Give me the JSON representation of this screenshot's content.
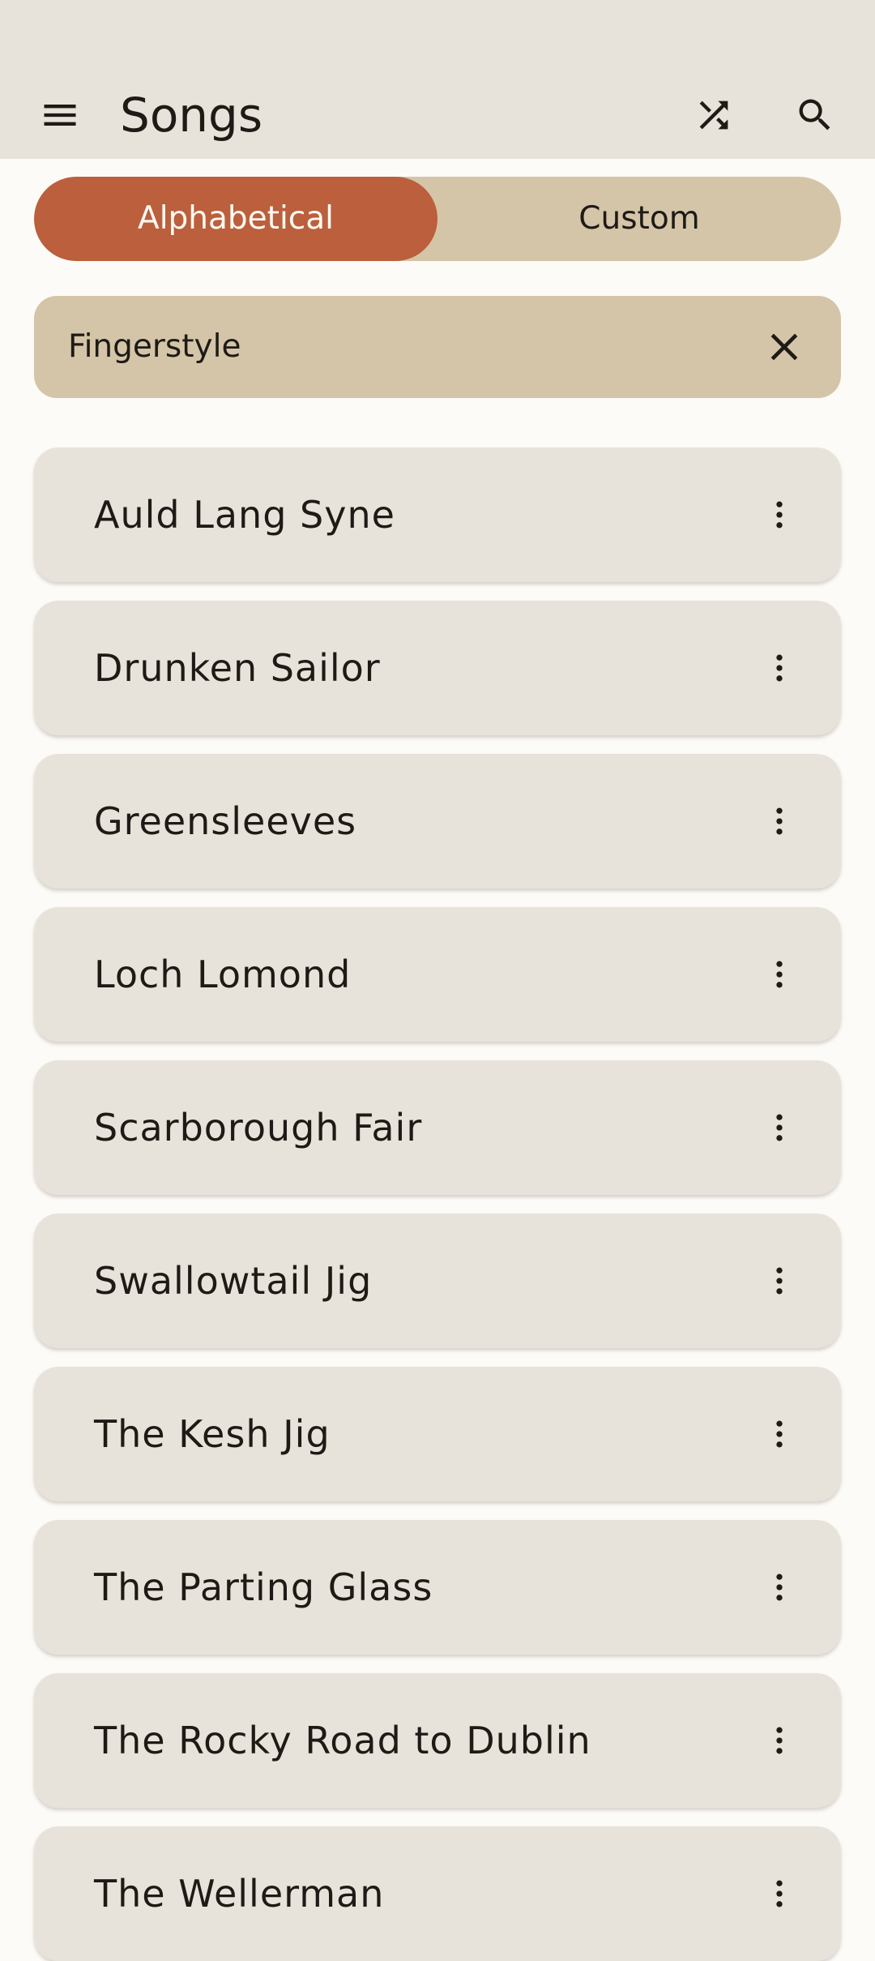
{
  "app_bar": {
    "title": "Songs",
    "menu_icon": "menu-icon",
    "shuffle_icon": "shuffle-icon",
    "search_icon": "search-icon"
  },
  "sort_toggle": {
    "options": [
      {
        "label": "Alphabetical",
        "selected": true
      },
      {
        "label": "Custom",
        "selected": false
      }
    ]
  },
  "filter": {
    "label": "Fingerstyle",
    "close_icon": "close-icon"
  },
  "songs": [
    {
      "title": "Auld Lang Syne"
    },
    {
      "title": "Drunken Sailor"
    },
    {
      "title": "Greensleeves"
    },
    {
      "title": "Loch Lomond"
    },
    {
      "title": "Scarborough Fair"
    },
    {
      "title": "Swallowtail Jig"
    },
    {
      "title": "The Kesh Jig"
    },
    {
      "title": "The Parting Glass"
    },
    {
      "title": "The Rocky Road to Dublin"
    },
    {
      "title": "The Wellerman"
    }
  ],
  "colors": {
    "app_bar_background": "#e8e3da",
    "page_background": "#fcfbf8",
    "accent": "#bb5f3d",
    "chip_background": "#d4c5a8",
    "card_background": "#e8e3da",
    "text": "#1e1a16"
  }
}
